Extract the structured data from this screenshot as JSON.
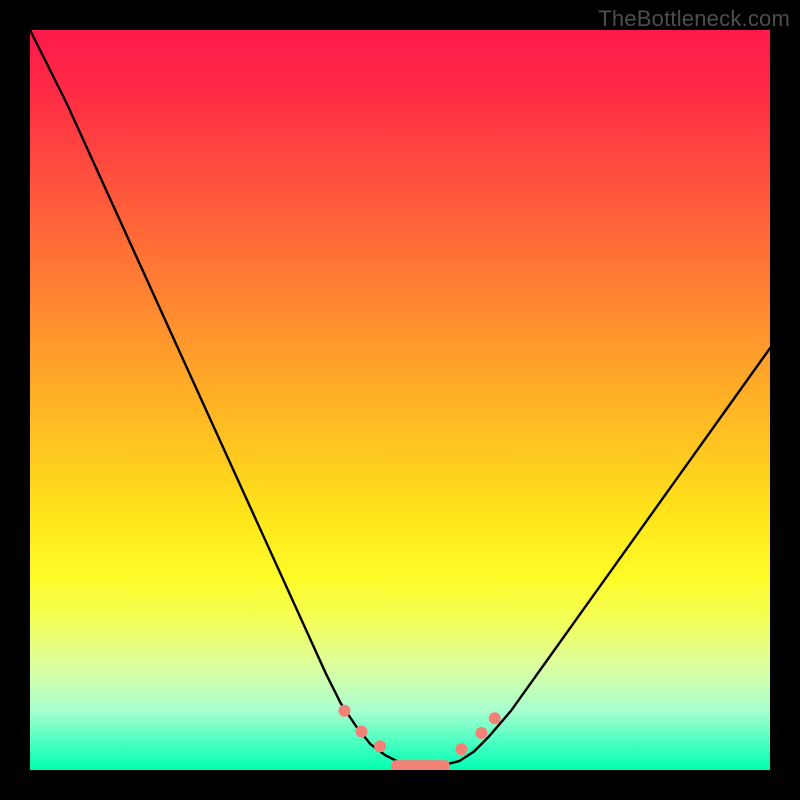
{
  "watermark": "TheBottleneck.com",
  "colors": {
    "frame": "#000000",
    "curve": "#000000",
    "marker": "#f28278",
    "gradient_top": "#ff1a4b",
    "gradient_bottom": "#00ffb0"
  },
  "chart_data": {
    "type": "line",
    "title": "",
    "xlabel": "",
    "ylabel": "",
    "xlim": [
      0,
      100
    ],
    "ylim": [
      0,
      100
    ],
    "grid": false,
    "legend": false,
    "x": [
      0,
      5,
      10,
      15,
      20,
      25,
      30,
      35,
      40,
      42,
      44,
      46,
      48,
      50,
      52,
      54,
      56,
      58,
      60,
      62,
      65,
      70,
      75,
      80,
      85,
      90,
      95,
      100
    ],
    "values": [
      100,
      90,
      79,
      68,
      57,
      46,
      35,
      24,
      13,
      9,
      6,
      3.5,
      2,
      1,
      0.5,
      0.5,
      0.7,
      1.2,
      2.5,
      4.5,
      8,
      15,
      22,
      29,
      36,
      43,
      50,
      57
    ],
    "markers": {
      "x": [
        42.5,
        44.8,
        47.3,
        58.3,
        61.0,
        62.8
      ],
      "y": [
        8.0,
        5.2,
        3.2,
        2.8,
        5.0,
        7.0
      ]
    },
    "plateau": {
      "x_start": 49.5,
      "x_end": 56.0,
      "y": 0.6
    }
  }
}
